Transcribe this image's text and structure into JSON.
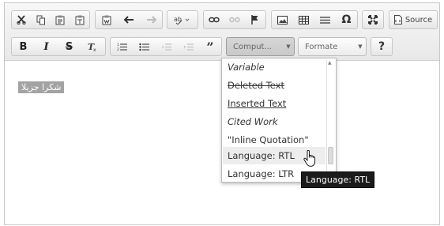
{
  "toolbar": {
    "source_label": "Source",
    "styles_combo": "Comput...",
    "format_combo": "Formate",
    "help_label": "?"
  },
  "content": {
    "selected_text": "شكرا جزيلا"
  },
  "styles_menu": {
    "items": [
      {
        "label": "Variable"
      },
      {
        "label": "Deleted Text"
      },
      {
        "label": "Inserted Text"
      },
      {
        "label": "Cited Work"
      },
      {
        "label": "\"Inline Quotation\""
      },
      {
        "label": "Language: RTL"
      },
      {
        "label": "Language: LTR"
      }
    ]
  },
  "tooltip": {
    "text": "Language: RTL"
  }
}
